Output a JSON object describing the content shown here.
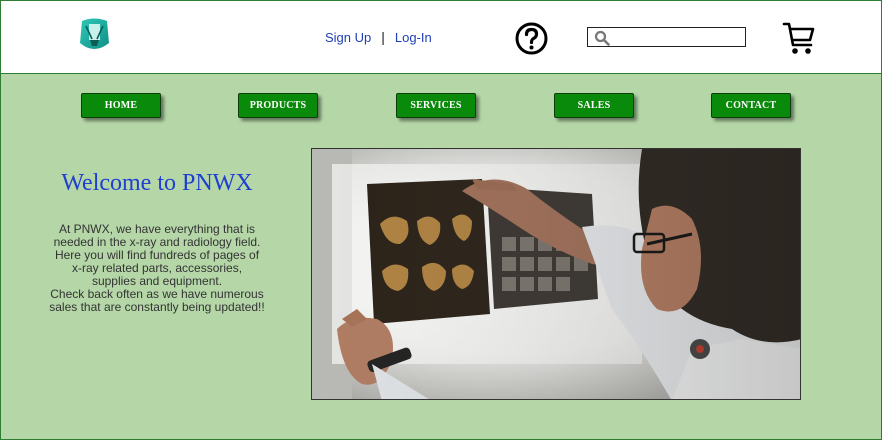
{
  "header": {
    "logo_icon": "xray-logo-icon",
    "auth": {
      "signup_label": "Sign Up",
      "separator": "|",
      "login_label": "Log-In"
    },
    "help_icon": "question-circle-icon",
    "search": {
      "placeholder": "",
      "value": "",
      "icon": "search-icon"
    },
    "cart_icon": "shopping-cart-icon"
  },
  "nav": {
    "items": [
      {
        "label": "HOME"
      },
      {
        "label": "PRODUCTS"
      },
      {
        "label": "SERVICES"
      },
      {
        "label": "SALES"
      },
      {
        "label": "CONTACT"
      }
    ]
  },
  "main": {
    "title": "Welcome to PNWX",
    "intro": [
      "At PNWX, we have everything that is needed in the x-ray and radiology field. Here you will find fundreds of pages of x-ray related parts, accessories, supplies and equipment.",
      "Check back often as we have numerous sales that are constantly being updated!!"
    ],
    "hero_image": "doctor-reviewing-xray-films-image"
  },
  "colors": {
    "page_background": "#b5d7a8",
    "header_background": "#ffffff",
    "border": "#2e7d32",
    "nav_button": "#0a8a0a",
    "link": "#1f3fb4",
    "title": "#1f3fd0"
  }
}
